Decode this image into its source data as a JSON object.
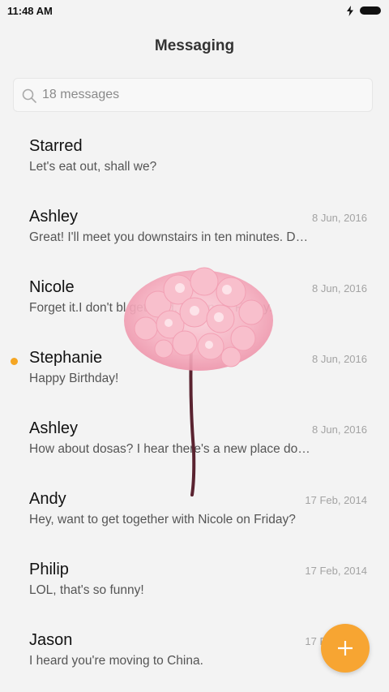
{
  "status_bar": {
    "time": "11:48 AM",
    "icons": [
      "bolt-icon",
      "battery-icon"
    ]
  },
  "header": {
    "title": "Messaging"
  },
  "search": {
    "placeholder": "18 messages",
    "icon": "search-icon"
  },
  "conversations": [
    {
      "name": "Starred",
      "date": "",
      "preview": "Let's eat out, shall we?",
      "unread": false
    },
    {
      "name": "Ashley",
      "date": "8 Jun, 2016",
      "preview": "Great! I'll meet you downstairs in ten minutes. D…",
      "unread": false
    },
    {
      "name": "Nicole",
      "date": "8 Jun, 2016",
      "preview": "Forget it.I don't bl get paid, until next Friday.",
      "unread": false
    },
    {
      "name": "Stephanie",
      "date": "8 Jun, 2016",
      "preview": "Happy Birthday!",
      "unread": true
    },
    {
      "name": "Ashley",
      "date": "8 Jun, 2016",
      "preview": "How about dosas? I hear there's a new place do…",
      "unread": false
    },
    {
      "name": "Andy",
      "date": "17 Feb, 2014",
      "preview": "Hey, want to get together with Nicole on Friday?",
      "unread": false
    },
    {
      "name": "Philip",
      "date": "17 Feb, 2014",
      "preview": "LOL, that's so funny!",
      "unread": false
    },
    {
      "name": "Jason",
      "date": "17 Feb, 2014",
      "preview": "I heard you're moving to China.",
      "unread": false
    }
  ],
  "fab": {
    "icon": "plus-icon"
  },
  "colors": {
    "accent": "#f7a532",
    "background": "#f3f3f3",
    "unread_dot": "#f5a623"
  }
}
